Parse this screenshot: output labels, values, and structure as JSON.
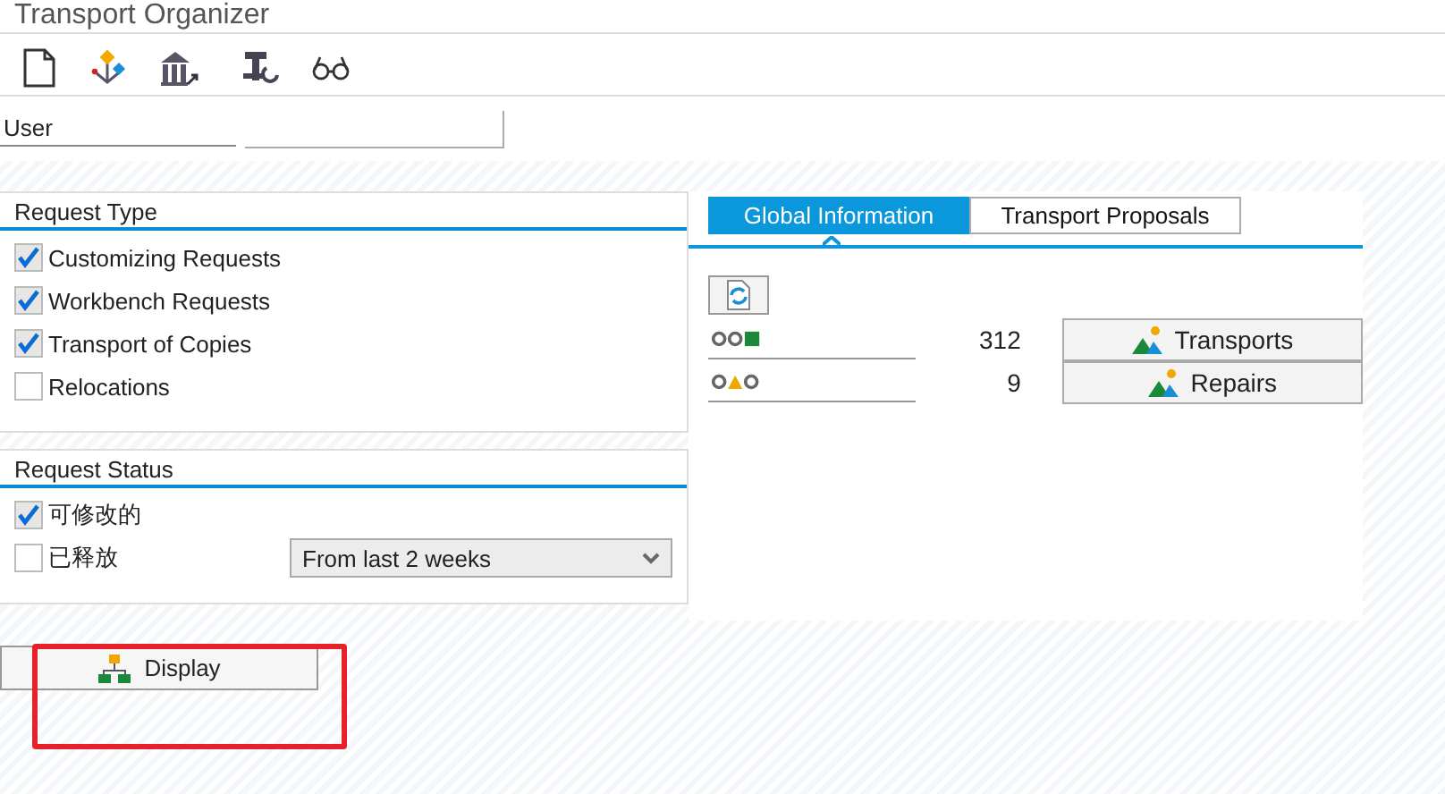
{
  "window": {
    "title": "Transport Organizer"
  },
  "user": {
    "label": "User"
  },
  "request_type": {
    "title": "Request Type",
    "options": [
      {
        "label": "Customizing Requests",
        "checked": true
      },
      {
        "label": "Workbench Requests",
        "checked": true
      },
      {
        "label": "Transport of Copies",
        "checked": true
      },
      {
        "label": "Relocations",
        "checked": false
      }
    ]
  },
  "request_status": {
    "title": "Request Status",
    "options": [
      {
        "label": "可修改的",
        "checked": true
      },
      {
        "label": "已释放",
        "checked": false
      }
    ],
    "period": "From last 2 weeks"
  },
  "tabs": [
    {
      "label": "Global Information",
      "selected": true
    },
    {
      "label": "Transport Proposals",
      "selected": false
    }
  ],
  "summary": [
    {
      "kind": "green",
      "count": "312",
      "button": "Transports"
    },
    {
      "kind": "yellow",
      "count": "9",
      "button": "Repairs"
    }
  ],
  "display_button": "Display"
}
